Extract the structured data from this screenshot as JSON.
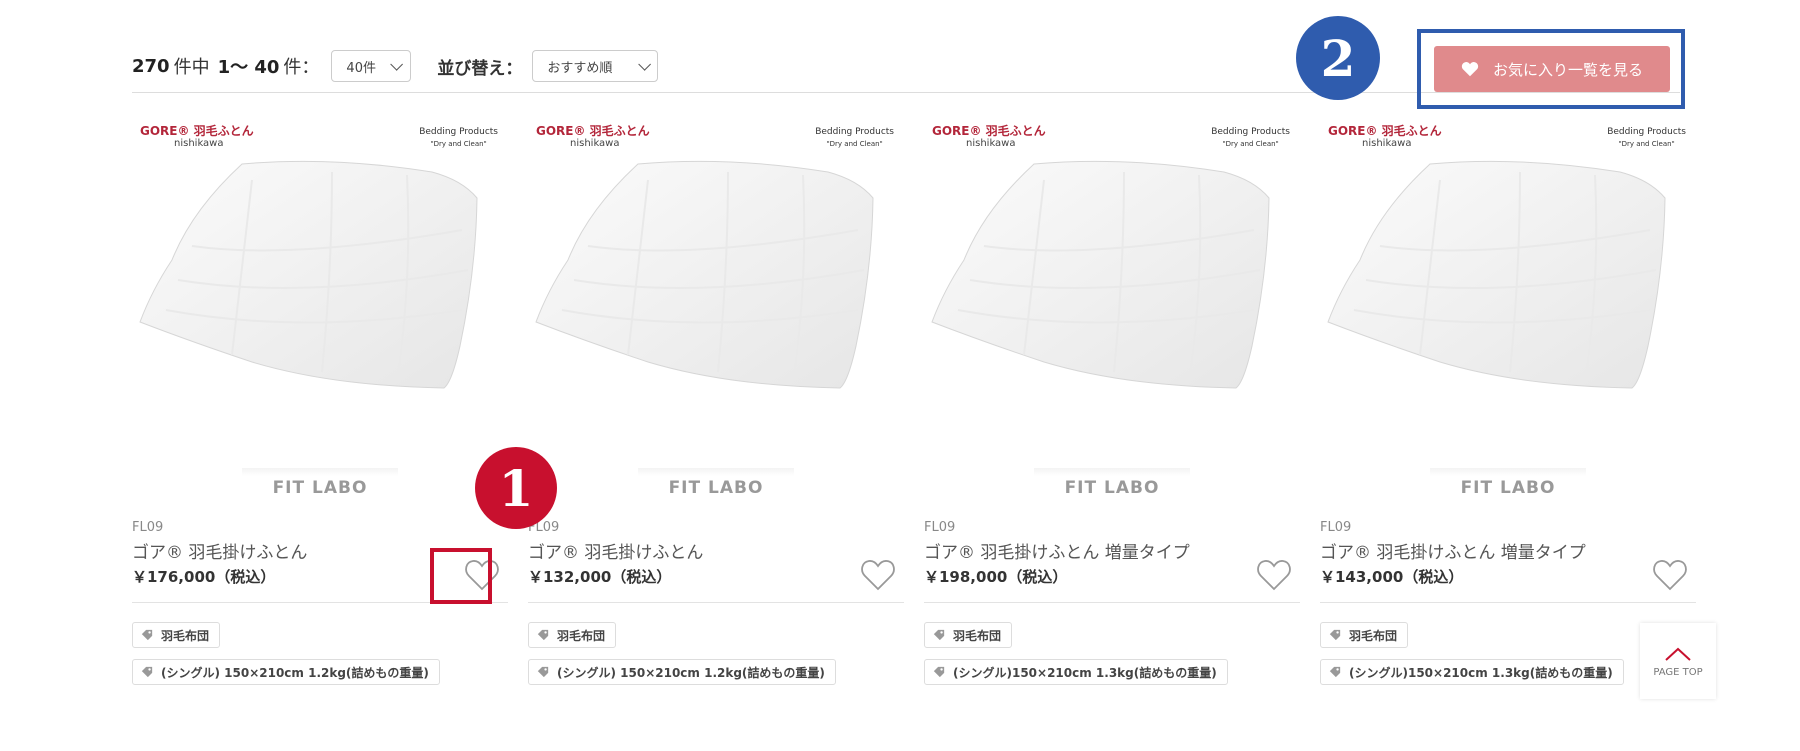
{
  "toolbar": {
    "total": "270",
    "total_suffix": "件中",
    "range": "1〜 40",
    "range_suffix": "件：",
    "per_page": "40件",
    "sort_label": "並び替え：",
    "sort_value": "おすすめ順"
  },
  "favorites_button": {
    "label": "お気に入り一覧を見る"
  },
  "annotations": {
    "badge_1": "1",
    "badge_2": "2"
  },
  "page_top": {
    "label": "PAGE TOP"
  },
  "colors": {
    "favorites_bg": "#e08a8c",
    "annotation_blue": "#2f5cae",
    "annotation_red": "#c8102e"
  },
  "products": [
    {
      "brand_gore": "GORE® 羽毛ふとん",
      "brand_nishikawa": "nishikawa",
      "brand_bedding": "Bedding Products",
      "brand_bedding_sub": "\"Dry and Clean\"",
      "label": "FIT LABO",
      "code": "FL09",
      "name": "ゴア® 羽毛掛けふとん",
      "price": "￥176,000（税込）",
      "tag1": "羽毛布団",
      "tag2": "(シングル) 150×210cm 1.2kg(詰めもの重量)"
    },
    {
      "brand_gore": "GORE® 羽毛ふとん",
      "brand_nishikawa": "nishikawa",
      "brand_bedding": "Bedding Products",
      "brand_bedding_sub": "\"Dry and Clean\"",
      "label": "FIT LABO",
      "code": "FL09",
      "name": "ゴア® 羽毛掛けふとん",
      "price": "￥132,000（税込）",
      "tag1": "羽毛布団",
      "tag2": "(シングル) 150×210cm 1.2kg(詰めもの重量)"
    },
    {
      "brand_gore": "GORE® 羽毛ふとん",
      "brand_nishikawa": "nishikawa",
      "brand_bedding": "Bedding Products",
      "brand_bedding_sub": "\"Dry and Clean\"",
      "label": "FIT LABO",
      "code": "FL09",
      "name": "ゴア® 羽毛掛けふとん 増量タイプ",
      "price": "￥198,000（税込）",
      "tag1": "羽毛布団",
      "tag2": "(シングル)150×210cm 1.3kg(詰めもの重量)"
    },
    {
      "brand_gore": "GORE® 羽毛ふとん",
      "brand_nishikawa": "nishikawa",
      "brand_bedding": "Bedding Products",
      "brand_bedding_sub": "\"Dry and Clean\"",
      "label": "FIT LABO",
      "code": "FL09",
      "name": "ゴア® 羽毛掛けふとん 増量タイプ",
      "price": "￥143,000（税込）",
      "tag1": "羽毛布団",
      "tag2": "(シングル)150×210cm 1.3kg(詰めもの重量)"
    }
  ]
}
